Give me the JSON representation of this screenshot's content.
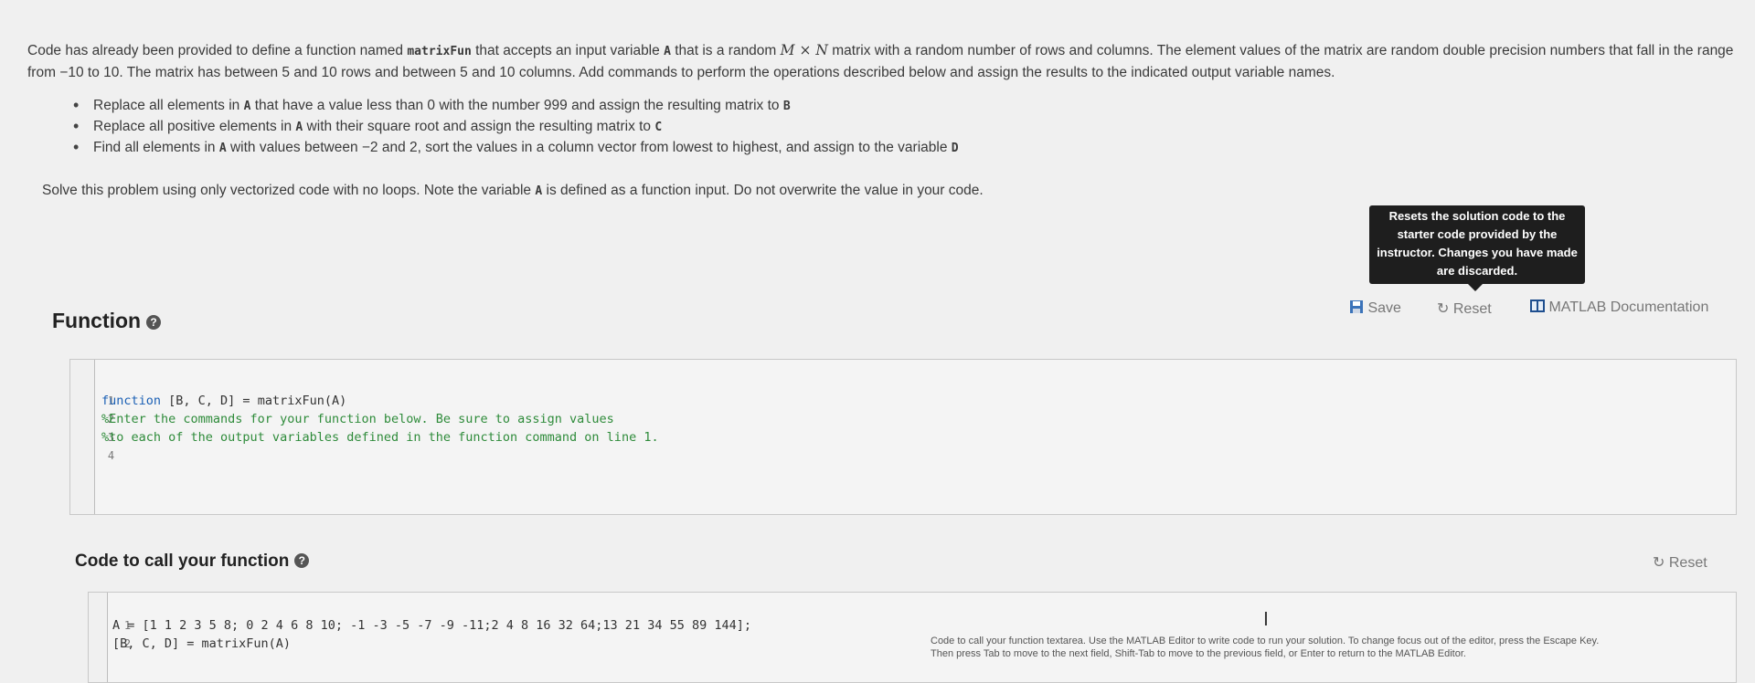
{
  "description": {
    "p1_a": "Code has already been provided to define a function named ",
    "p1_fn": "matrixFun",
    "p1_b": " that accepts an input variable ",
    "p1_A": "A",
    "p1_c": " that is a random ",
    "p1_math": "M × N",
    "p1_d": " matrix with a random number of rows and columns. The element values of the matrix are random double precision numbers that fall in the range from −10 to 10. The matrix has between 5 and 10 rows and between 5 and 10 columns. Add commands to perform the operations described below and assign the results to the indicated output variable names."
  },
  "bullets": [
    {
      "a": "Replace all elements in ",
      "v1": "A",
      "b": " that have a value less than 0 with the number 999 and assign the resulting matrix to ",
      "v2": "B"
    },
    {
      "a": "Replace all positive elements in ",
      "v1": "A",
      "b": " with their square root and assign the resulting matrix to ",
      "v2": "C"
    },
    {
      "a": "Find all elements in ",
      "v1": "A",
      "b": " with values between −2 and 2, sort the values in a column vector from lowest to highest, and assign to the variable ",
      "v2": "D"
    }
  ],
  "solve": {
    "a": "Solve this problem using only vectorized code with no loops. Note the variable ",
    "v": "A",
    "b": " is defined as a function input. Do not overwrite the value in your code."
  },
  "tooltip": "Resets the solution code to the starter code provided by the instructor. Changes you have made are discarded.",
  "function_section": {
    "title": "Function",
    "save_label": "Save",
    "reset_label": "Reset",
    "doc_label": "MATLAB Documentation",
    "lines": [
      {
        "num": "1",
        "kw": "function",
        "rest": " [B, C, D] = matrixFun(A)"
      },
      {
        "num": "2",
        "comment": "%Enter the commands for your function below. Be sure to assign values"
      },
      {
        "num": "3",
        "comment": "%to each of the output variables defined in the function command on line 1."
      },
      {
        "num": "4",
        "text": ""
      }
    ]
  },
  "call_section": {
    "title": "Code to call your function",
    "reset_label": "Reset",
    "lines": [
      {
        "num": "1",
        "text": "A = [1 1 2 3 5 8; 0 2 4 6 8 10; -1 -3 -5 -7 -9 -11;2 4 8 16 32 64;13 21 34 55 89 144];"
      },
      {
        "num": "2",
        "text": "[B, C, D] = matrixFun(A)"
      }
    ],
    "hint_line1": "Code to call your function textarea. Use the MATLAB Editor to write code to run your solution. To change focus out of the editor, press the Escape Key.",
    "hint_line2": "Then press Tab to move to the next field, Shift-Tab to move to the previous field, or Enter to return to the MATLAB Editor."
  }
}
